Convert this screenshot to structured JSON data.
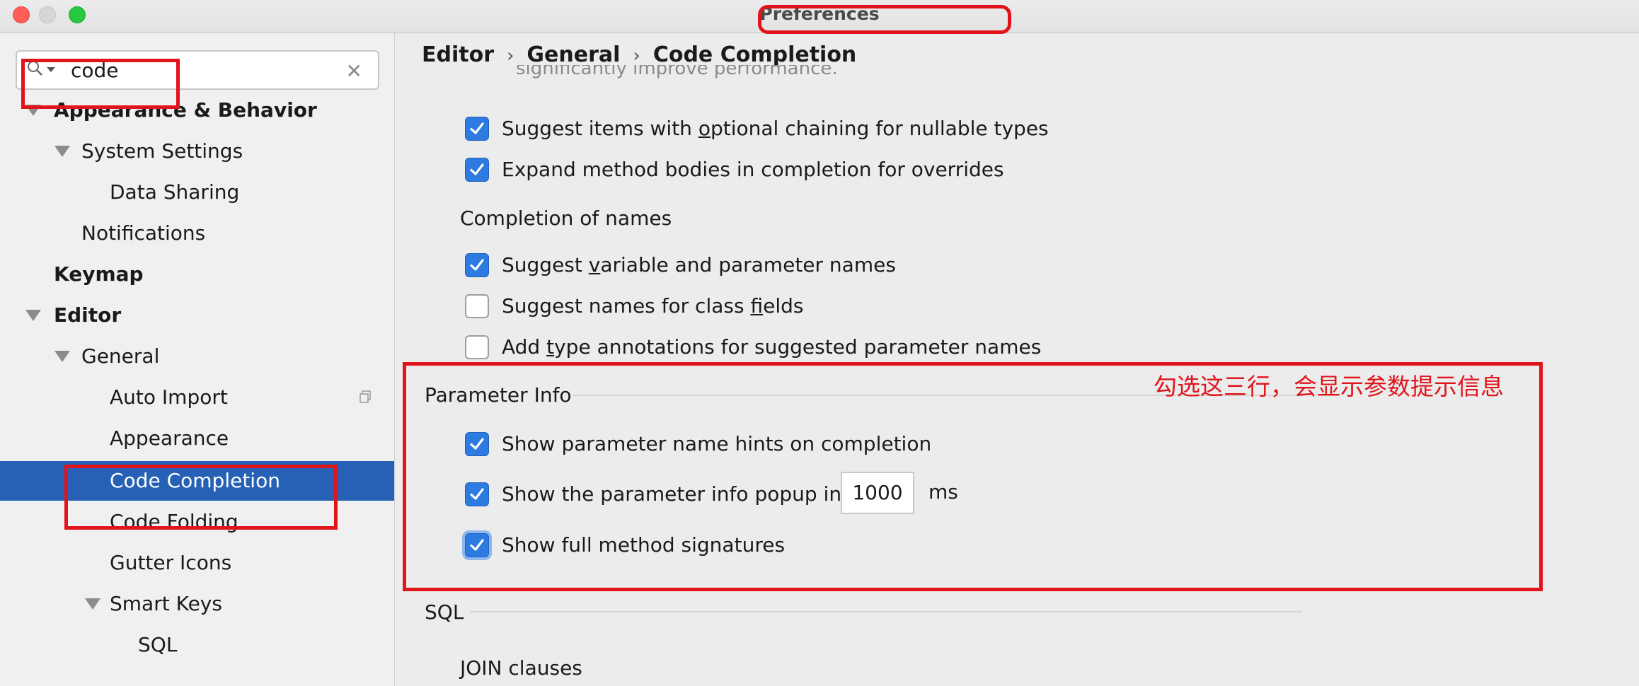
{
  "window": {
    "title": "Preferences"
  },
  "search": {
    "value": "code"
  },
  "tree": [
    {
      "label": "Appearance & Behavior",
      "bold": true,
      "expanded": true
    },
    {
      "label": "System Settings",
      "expanded": true
    },
    {
      "label": "Data Sharing"
    },
    {
      "label": "Notifications"
    },
    {
      "label": "Keymap",
      "bold": true
    },
    {
      "label": "Editor",
      "bold": true,
      "expanded": true
    },
    {
      "label": "General",
      "expanded": true
    },
    {
      "label": "Auto Import"
    },
    {
      "label": "Appearance"
    },
    {
      "label": "Code Completion",
      "selected": true
    },
    {
      "label": "Code Folding"
    },
    {
      "label": "Gutter Icons"
    },
    {
      "label": "Smart Keys",
      "expanded": true
    },
    {
      "label": "SQL"
    }
  ],
  "breadcrumb": [
    "Editor",
    "General",
    "Code Completion"
  ],
  "clipped_text": "significantly improve performance.",
  "options": {
    "optional_chaining": {
      "pre": "Suggest items with ",
      "mn": "o",
      "post": "ptional chaining for nullable types",
      "checked": true
    },
    "expand_bodies": {
      "pre": "Expand method bodies in completion for overrides",
      "mn": "",
      "post": "",
      "checked": true
    },
    "suggest_var_names": {
      "pre": "Suggest ",
      "mn": "v",
      "post": "ariable and parameter names",
      "checked": true
    },
    "suggest_field_names": {
      "pre": "Suggest names for class ",
      "mn": "f",
      "post": "ields",
      "checked": false
    },
    "type_annotations": {
      "pre": "Add ",
      "mn": "t",
      "post": "ype annotations for suggested parameter names",
      "checked": false
    },
    "param_name_hints": {
      "pre": "Show parameter name hints on completion",
      "mn": "",
      "post": "",
      "checked": true
    },
    "param_info_popup": {
      "pre": "Show the parameter info popup in",
      "mn": "",
      "post": "",
      "checked": true
    },
    "full_signatures": {
      "pre": "Show full method signatures",
      "mn": "",
      "post": "",
      "checked": true
    }
  },
  "sections": {
    "completion_of_names": "Completion of names",
    "parameter_info": "Parameter Info",
    "sql": "SQL",
    "join_clauses": "JOIN clauses"
  },
  "popup_delay": {
    "value": "1000",
    "unit": "ms"
  },
  "annotation": {
    "note": "勾选这三行，会显示参数提示信息",
    "color": "#e1141c"
  }
}
